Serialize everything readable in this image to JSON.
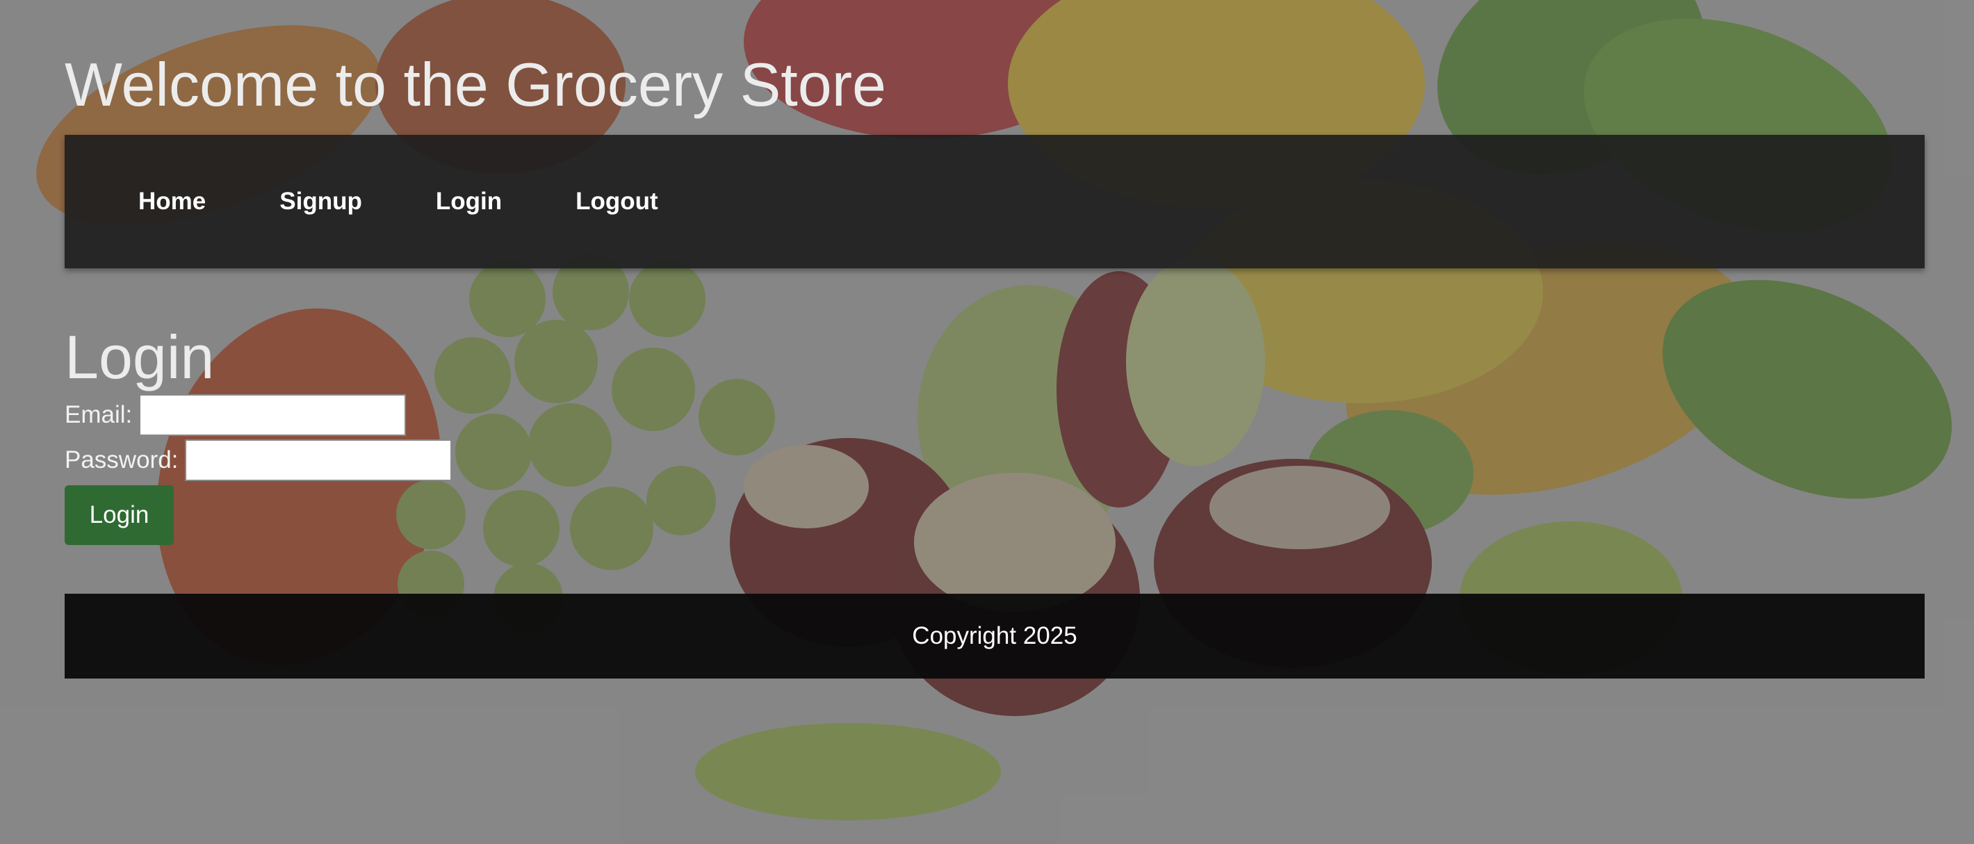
{
  "header": {
    "title": "Welcome to the Grocery Store"
  },
  "nav": {
    "items": [
      {
        "label": "Home"
      },
      {
        "label": "Signup"
      },
      {
        "label": "Login"
      },
      {
        "label": "Logout"
      }
    ]
  },
  "login_form": {
    "heading": "Login",
    "email_label": "Email:",
    "email_value": "",
    "password_label": "Password:",
    "password_value": "",
    "submit_label": "Login"
  },
  "footer": {
    "text": "Copyright 2025"
  },
  "colors": {
    "nav_background": "#1e1e1e",
    "button": "#2f6a33",
    "footer_background": "#0a0a0a"
  },
  "background": {
    "icon": "fruit-illustration"
  }
}
